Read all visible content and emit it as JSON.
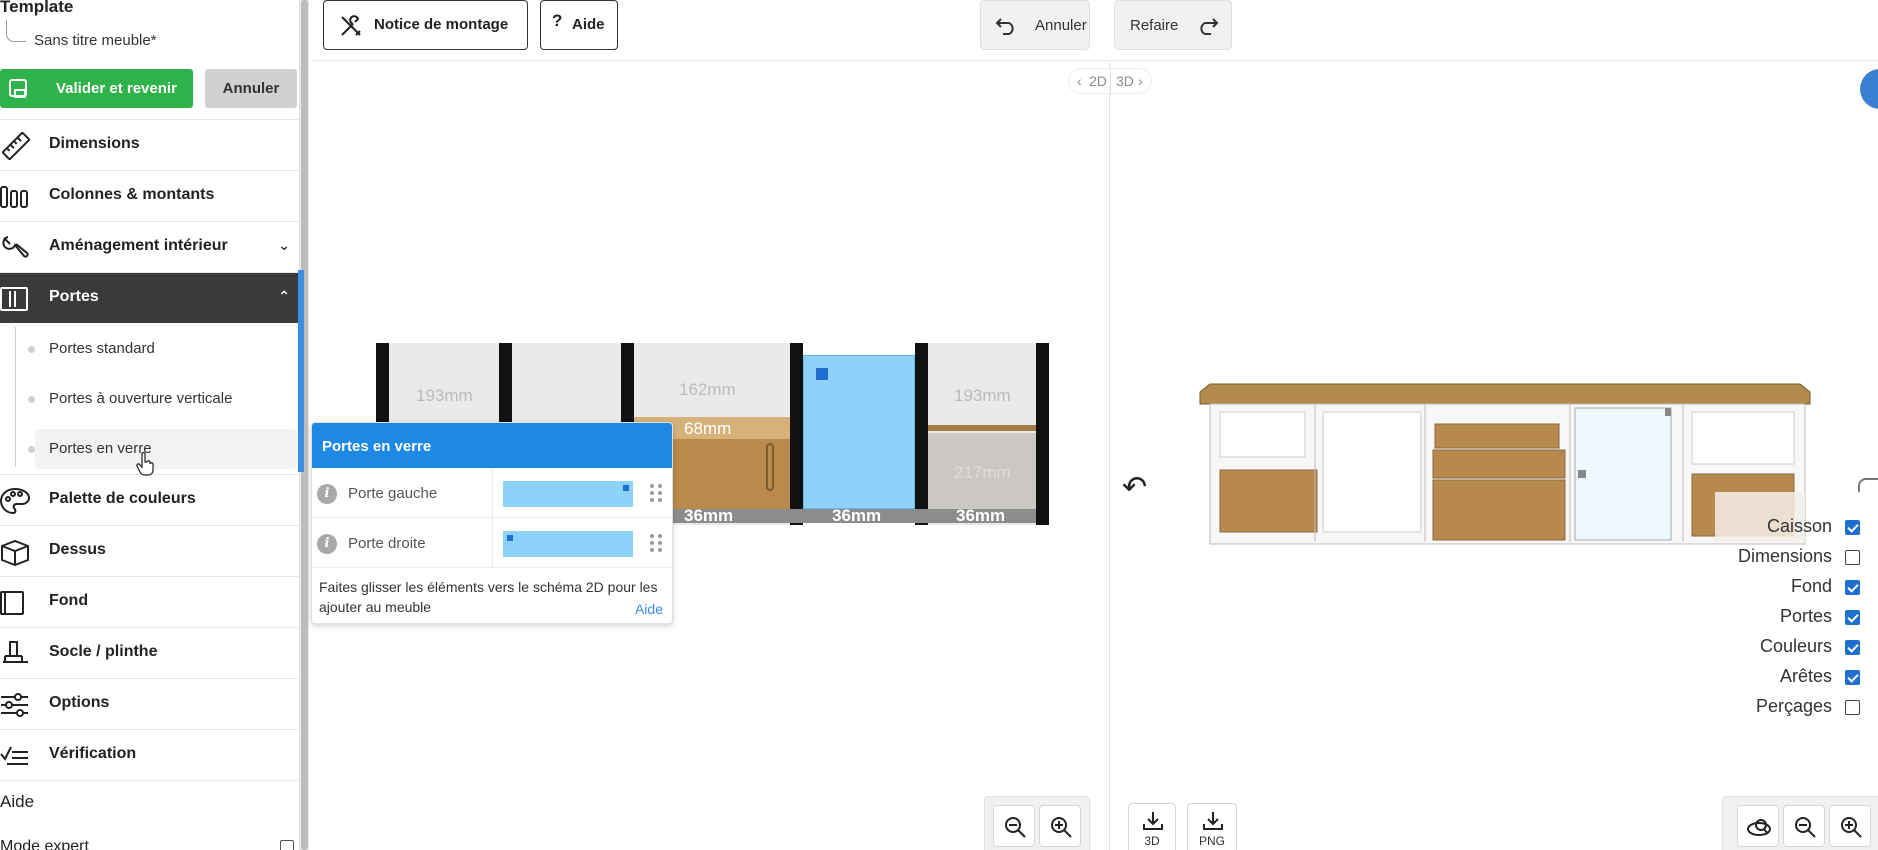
{
  "sidebar": {
    "template_title": "Template",
    "template_name": "Sans titre meuble*",
    "validate_label": "Valider et revenir",
    "cancel_label": "Annuler",
    "menu": [
      {
        "label": "Dimensions",
        "icon": "ruler-icon"
      },
      {
        "label": "Colonnes & montants",
        "icon": "columns-icon"
      },
      {
        "label": "Aménagement intérieur",
        "icon": "wrench-icon"
      },
      {
        "label": "Portes",
        "icon": "door-icon"
      },
      {
        "label": "Palette de couleurs",
        "icon": "palette-icon"
      },
      {
        "label": "Dessus",
        "icon": "box-icon"
      },
      {
        "label": "Fond",
        "icon": "back-panel-icon"
      },
      {
        "label": "Socle / plinthe",
        "icon": "plinth-icon"
      },
      {
        "label": "Options",
        "icon": "sliders-icon"
      },
      {
        "label": "Vérification",
        "icon": "checklist-icon"
      }
    ],
    "portes_sub": [
      "Portes standard",
      "Portes à ouverture verticale",
      "Portes en verre"
    ],
    "aide": "Aide",
    "expert": "Mode expert"
  },
  "toolbar": {
    "notice": "Notice de montage",
    "aide": "Aide",
    "undo": "Annuler",
    "redo": "Refaire"
  },
  "view_toggle": {
    "left": "2D",
    "right": "3D"
  },
  "schema": {
    "dims_top": [
      "193mm",
      "162mm",
      "193mm"
    ],
    "drawer": "68mm",
    "drawer_right": "217mm",
    "bottom": [
      "36mm",
      "36mm",
      "36mm"
    ]
  },
  "popup": {
    "title": "Portes en verre",
    "rows": [
      "Porte gauche",
      "Porte droite"
    ],
    "hint": "Faites glisser les éléments vers le schéma 2D pour les ajouter au meuble",
    "help": "Aide"
  },
  "legend": [
    {
      "label": "Caisson",
      "checked": true
    },
    {
      "label": "Dimensions",
      "checked": false
    },
    {
      "label": "Fond",
      "checked": true
    },
    {
      "label": "Portes",
      "checked": true
    },
    {
      "label": "Couleurs",
      "checked": true
    },
    {
      "label": "Arêtes",
      "checked": true
    },
    {
      "label": "Perçages",
      "checked": false
    }
  ],
  "export": {
    "three_d": "3D",
    "png": "PNG"
  },
  "colors": {
    "accent": "#1e88e5",
    "success": "#2db34a",
    "active": "#3a3a3a",
    "glass": "#8dd2f8",
    "wood": "#b58a4e"
  }
}
